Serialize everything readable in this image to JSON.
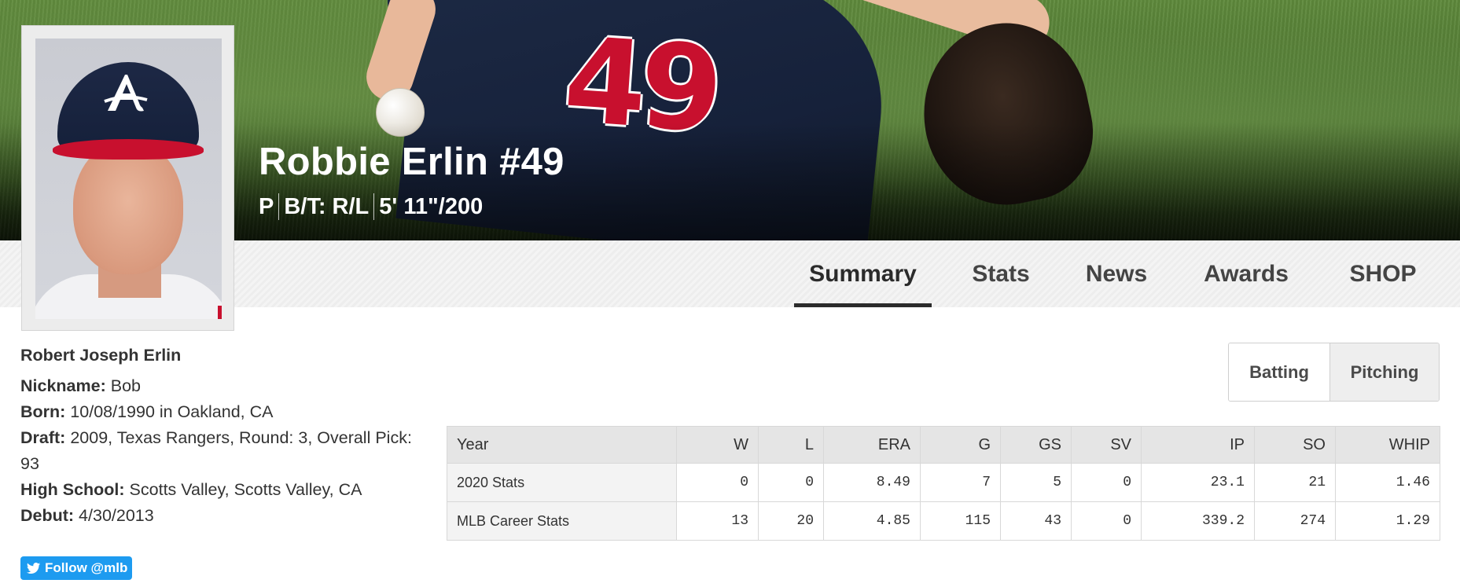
{
  "player": {
    "name": "Robbie Erlin #49",
    "position": "P",
    "bats_throws": "B/T: R/L",
    "height_weight": "5' 11\"/200",
    "jersey_number": "49"
  },
  "tabs": [
    {
      "label": "Summary",
      "active": true
    },
    {
      "label": "Stats",
      "active": false
    },
    {
      "label": "News",
      "active": false
    },
    {
      "label": "Awards",
      "active": false
    },
    {
      "label": "SHOP",
      "active": false
    }
  ],
  "bio": {
    "full_name": "Robert Joseph Erlin",
    "nickname_label": "Nickname:",
    "nickname": " Bob",
    "born_label": "Born:",
    "born": " 10/08/1990 in Oakland, CA",
    "draft_label": "Draft:",
    "draft": " 2009, Texas Rangers, Round: 3, Overall Pick: 93",
    "high_school_label": "High School:",
    "high_school": " Scotts Valley, Scotts Valley, CA",
    "debut_label": "Debut:",
    "debut": " 4/30/2013"
  },
  "social": {
    "follow_label": "Follow @mlb",
    "icon": "twitter-bird-icon",
    "color": "#1d9bf0"
  },
  "stat_toggle": {
    "options": [
      "Batting",
      "Pitching"
    ],
    "selected": "Pitching"
  },
  "stats": {
    "columns": [
      "Year",
      "W",
      "L",
      "ERA",
      "G",
      "GS",
      "SV",
      "IP",
      "SO",
      "WHIP"
    ],
    "rows": [
      [
        "2020 Stats",
        "0",
        "0",
        "8.49",
        "7",
        "5",
        "0",
        "23.1",
        "21",
        "1.46"
      ],
      [
        "MLB Career Stats",
        "13",
        "20",
        "4.85",
        "115",
        "43",
        "0",
        "339.2",
        "274",
        "1.29"
      ]
    ]
  },
  "colors": {
    "team_navy": "#1d2845",
    "team_red": "#c8102e",
    "tab_underline": "#2b2b2b"
  }
}
